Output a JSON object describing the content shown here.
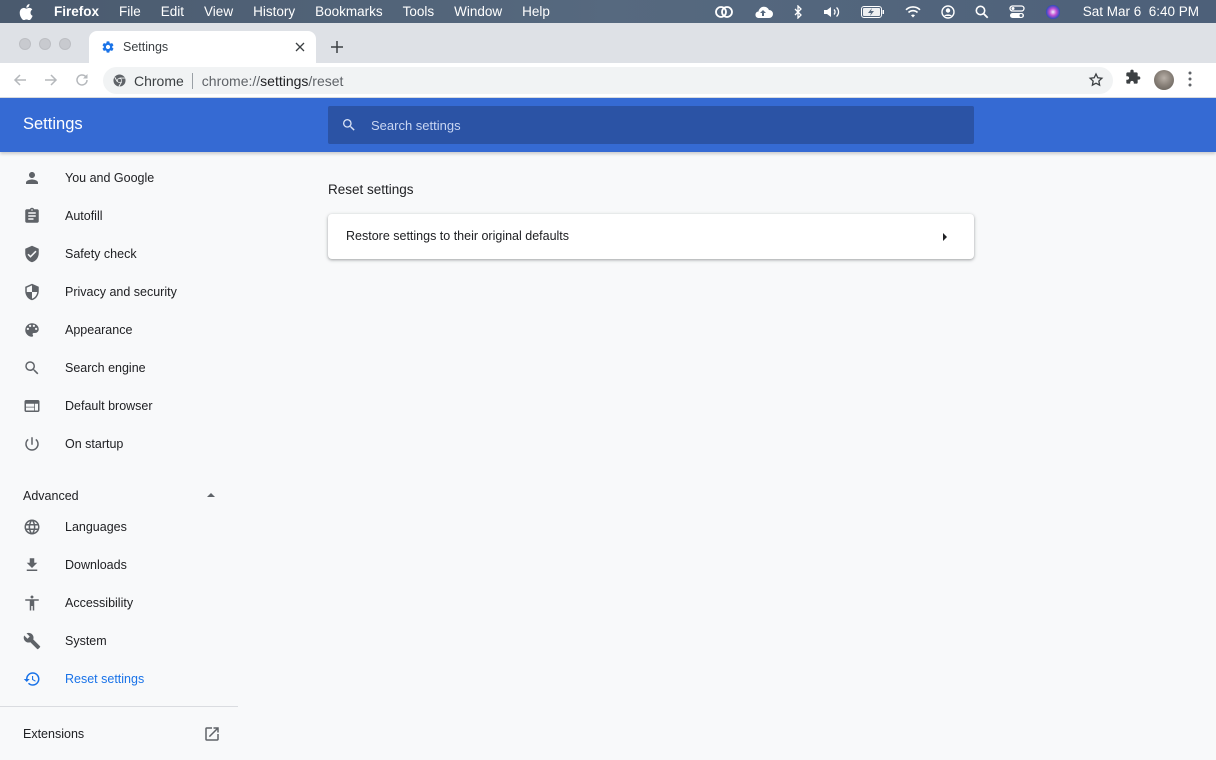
{
  "menubar": {
    "app": "Firefox",
    "items": [
      "File",
      "Edit",
      "View",
      "History",
      "Bookmarks",
      "Tools",
      "Window",
      "Help"
    ],
    "status_icons": [
      "creative-cloud-icon",
      "cloud-upload-icon",
      "bluetooth-icon",
      "volume-icon",
      "battery-charging-icon",
      "wifi-icon",
      "user-account-icon",
      "spotlight-search-icon",
      "control-center-icon",
      "siri-icon"
    ],
    "clock": "Sat Mar 6  6:40 PM"
  },
  "browser": {
    "tab": {
      "title": "Settings",
      "icon": "settings-gear-icon"
    },
    "omnibox": {
      "chip": "Chrome",
      "url_prefix": "chrome://",
      "url_host": "settings",
      "url_path": "/reset"
    }
  },
  "header": {
    "title": "Settings",
    "search_placeholder": "Search settings"
  },
  "sidebar": {
    "items": [
      {
        "label": "You and Google",
        "icon": "person-icon"
      },
      {
        "label": "Autofill",
        "icon": "clipboard-icon"
      },
      {
        "label": "Safety check",
        "icon": "shield-check-icon"
      },
      {
        "label": "Privacy and security",
        "icon": "shield-half-icon"
      },
      {
        "label": "Appearance",
        "icon": "palette-icon"
      },
      {
        "label": "Search engine",
        "icon": "search-icon"
      },
      {
        "label": "Default browser",
        "icon": "browser-window-icon"
      },
      {
        "label": "On startup",
        "icon": "power-icon"
      }
    ],
    "advanced_label": "Advanced",
    "advanced_items": [
      {
        "label": "Languages",
        "icon": "globe-icon"
      },
      {
        "label": "Downloads",
        "icon": "download-icon"
      },
      {
        "label": "Accessibility",
        "icon": "accessibility-icon"
      },
      {
        "label": "System",
        "icon": "wrench-icon"
      },
      {
        "label": "Reset settings",
        "icon": "restore-history-icon",
        "active": true
      }
    ],
    "extensions_label": "Extensions"
  },
  "main": {
    "section_title": "Reset settings",
    "rows": [
      {
        "label": "Restore settings to their original defaults"
      }
    ]
  },
  "colors": {
    "header_blue": "#356ad3",
    "search_bg": "#2b53a5",
    "active_blue": "#1a73e8",
    "page_bg": "#f8f9fa"
  }
}
